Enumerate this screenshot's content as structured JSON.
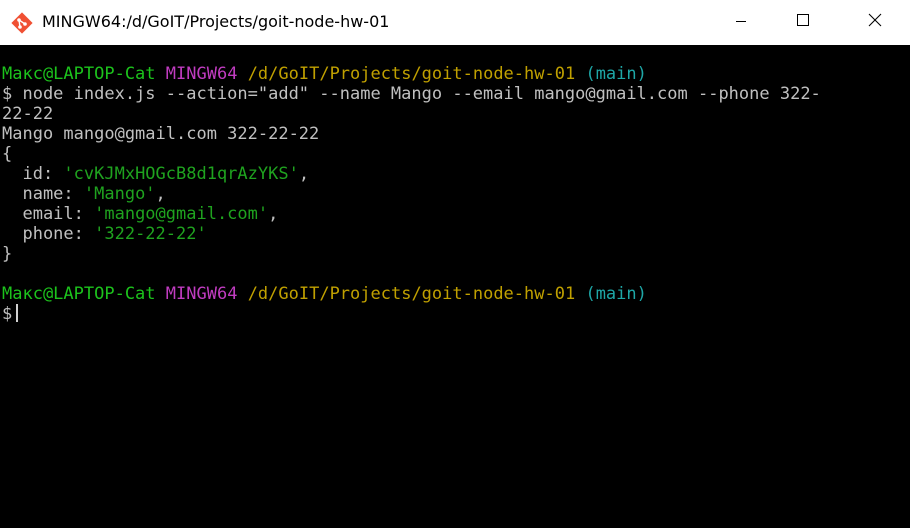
{
  "window": {
    "title": "MINGW64:/d/GoIT/Projects/goit-node-hw-01"
  },
  "terminal": {
    "prompt1": {
      "user_host": "Макс@LAPTOP-Cat",
      "system": "MINGW64",
      "path": "/d/GoIT/Projects/goit-node-hw-01",
      "branch": "(main)"
    },
    "command_line1": "$ node index.js --action=\"add\" --name Mango --email mango@gmail.com --phone 322-",
    "command_line2": "22-22",
    "output_line": "Mango mango@gmail.com 322-22-22",
    "brace_open": "{",
    "obj": {
      "id_key": "  id: ",
      "id_val": "'cvKJMxHOGcB8d1qrAzYKS'",
      "name_key": "  name: ",
      "name_val": "'Mango'",
      "email_key": "  email: ",
      "email_val": "'mango@gmail.com'",
      "phone_key": "  phone: ",
      "phone_val": "'322-22-22'",
      "comma": ","
    },
    "brace_close": "}",
    "prompt2": {
      "user_host": "Макс@LAPTOP-Cat",
      "system": "MINGW64",
      "path": "/d/GoIT/Projects/goit-node-hw-01",
      "branch": "(main)"
    },
    "prompt_symbol": "$"
  },
  "colors": {
    "user_host": "#1cc21c",
    "system": "#c03cc0",
    "path": "#c0a000",
    "branch": "#1ea7a7",
    "string": "#1fa31f",
    "default_text": "#c0c0c0",
    "background": "#000000"
  },
  "icons": {
    "app": "git-bash-icon",
    "minimize": "minimize-icon",
    "maximize": "maximize-icon",
    "close": "close-icon"
  }
}
